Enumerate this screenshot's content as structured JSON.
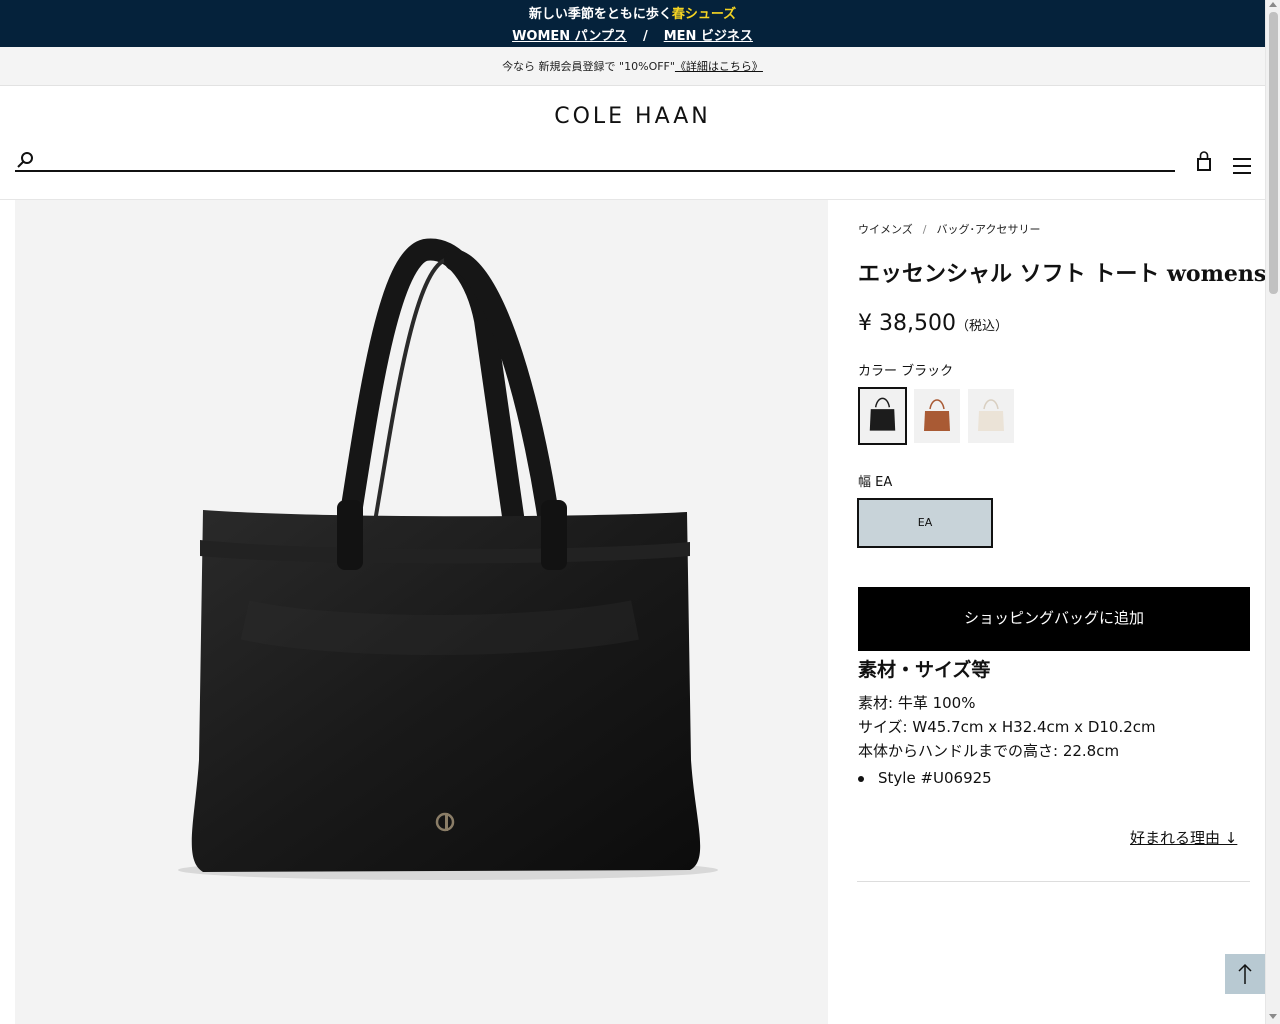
{
  "promo": {
    "headline": "新しい季節をともに歩く",
    "headline_highlight": "春シューズ",
    "women_link": "WOMEN パンプス",
    "separator": "/",
    "men_link": "MEN ビジネス"
  },
  "member_bar": {
    "text": "今なら 新規会員登録で \"10%OFF\"",
    "link": "《詳細はこちら》"
  },
  "header": {
    "logo": "COLE HAAN",
    "search_placeholder": ""
  },
  "breadcrumb": {
    "items": [
      "ウイメンズ",
      "バッグ･アクセサリー"
    ],
    "separator": "/"
  },
  "product": {
    "title": "エッセンシャル ソフト トート womens",
    "price": "¥ 38,500",
    "price_note": "（税込）",
    "color_label": "カラー ブラック",
    "swatches": [
      {
        "name": "ブラック",
        "color": "#1c1c1c",
        "selected": true
      },
      {
        "name": "ブラウン",
        "color": "#a95a34",
        "selected": false
      },
      {
        "name": "アイボリー",
        "color": "#ebe3d7",
        "selected": false
      }
    ],
    "width_label": "幅 EA",
    "width_option": "EA",
    "add_to_bag": "ショッピングバッグに追加"
  },
  "specs": {
    "title": "素材・サイズ等",
    "material": "素材: 牛革 100%",
    "size": "サイズ: W45.7cm x H32.4cm x D10.2cm",
    "handle": "本体からハンドルまでの高さ: 22.8cm",
    "style": "Style #U06925"
  },
  "why_link": "好まれる理由 ↓",
  "colors": {
    "promo_bg": "#05223b",
    "highlight": "#f5d422",
    "width_selected_bg": "#c8d3d9",
    "to_top_bg": "#b8c9d2"
  }
}
